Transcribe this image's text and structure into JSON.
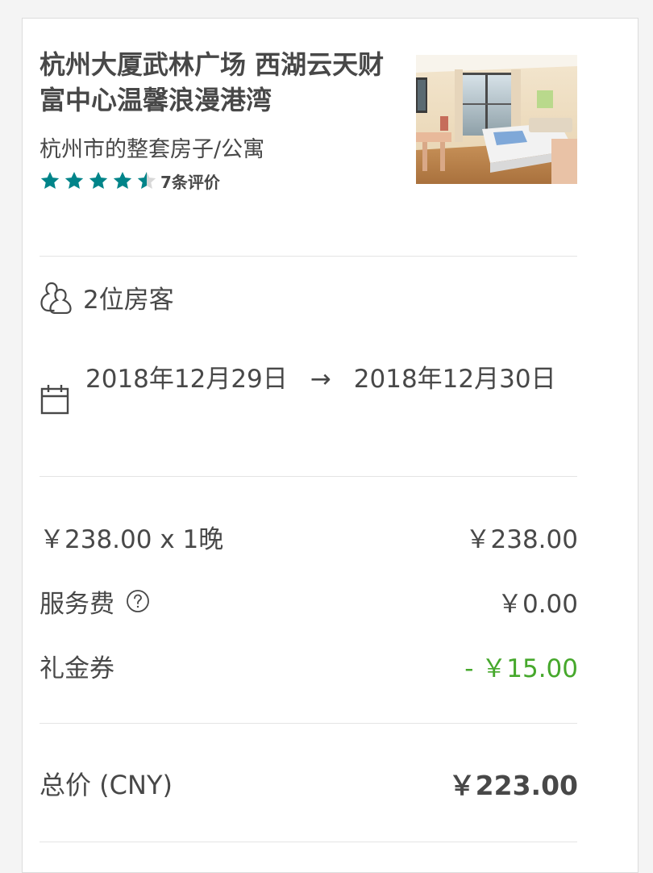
{
  "listing": {
    "title": "杭州大厦武林广场 西湖云天财富中心温馨浪漫港湾",
    "subtitle": "杭州市的整套房子/公寓",
    "rating_stars": 4.5,
    "review_count": "7条评价",
    "star_color": "#008489",
    "photo": "hotel-room-photo"
  },
  "trip": {
    "guests": "2位房客",
    "check_in": "2018年12月29日",
    "arrow": "→",
    "check_out": "2018年12月30日"
  },
  "pricing": {
    "nightly_label": "￥238.00 x 1晚",
    "nightly_amount": "￥238.00",
    "service_fee_label": "服务费",
    "service_fee_amount": "￥0.00",
    "coupon_label": "礼金券",
    "coupon_amount": "- ￥15.00",
    "total_label": "总价 (CNY)",
    "total_amount": "￥223.00",
    "discount_color": "#46a82c"
  }
}
